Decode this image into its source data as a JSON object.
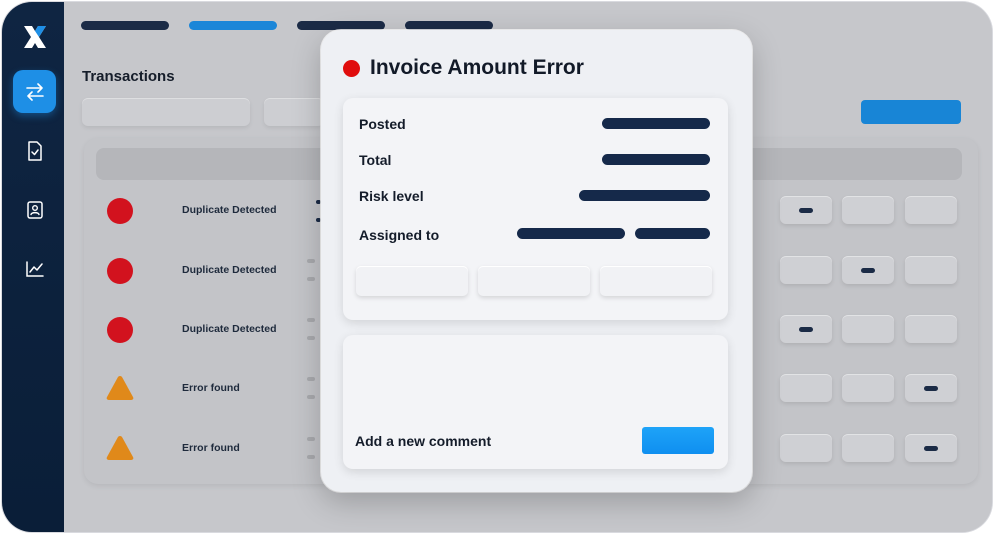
{
  "app": {
    "logo_letter": "X"
  },
  "sidebar": {
    "items": [
      {
        "name": "transactions",
        "icon": "transfer-arrows-icon",
        "active": true
      },
      {
        "name": "documents",
        "icon": "document-check-icon",
        "active": false
      },
      {
        "name": "contacts",
        "icon": "contact-card-icon",
        "active": false
      },
      {
        "name": "analytics",
        "icon": "line-chart-icon",
        "active": false
      }
    ]
  },
  "page": {
    "title": "Transactions"
  },
  "table": {
    "rows": [
      {
        "status": "error",
        "label": "Duplicate Detected"
      },
      {
        "status": "error",
        "label": "Duplicate Detected"
      },
      {
        "status": "error",
        "label": "Duplicate Detected"
      },
      {
        "status": "warning",
        "label": "Error found"
      },
      {
        "status": "warning",
        "label": "Error found"
      }
    ]
  },
  "modal": {
    "title": "Invoice Amount Error",
    "fields": [
      {
        "label": "Posted"
      },
      {
        "label": "Total"
      },
      {
        "label": "Risk level"
      },
      {
        "label": "Assigned to"
      }
    ],
    "comment_label": "Add a new comment"
  },
  "colors": {
    "sidebar": "#0f2542",
    "accent": "#1e8fe6",
    "error": "#d2121e",
    "warning": "#e0891a",
    "placeholder_bar": "#15294a"
  }
}
